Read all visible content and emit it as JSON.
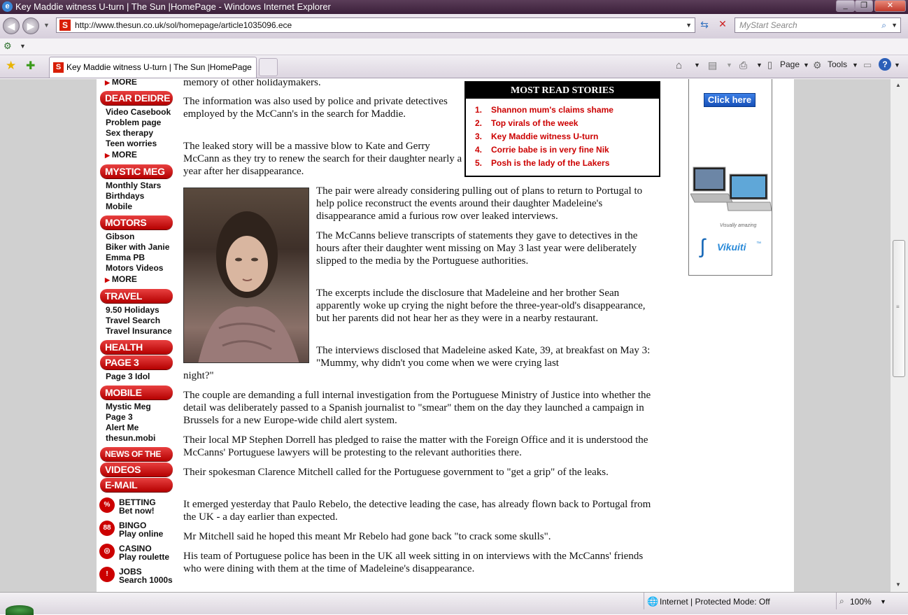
{
  "window": {
    "title": "Key Maddie witness U-turn | The Sun |HomePage - Windows Internet Explorer",
    "minimize": "_",
    "maximize": "❐",
    "close": "✕"
  },
  "browser": {
    "url": "http://www.thesun.co.uk/sol/homepage/article1035096.ece",
    "search_placeholder": "MyStart Search",
    "tab_title": "Key Maddie witness U-turn | The Sun |HomePage",
    "tools": {
      "page": "Page",
      "tools": "Tools"
    },
    "status_zone": "Internet | Protected Mode: Off",
    "zoom": "100%"
  },
  "leftnav": {
    "top_more": "MORE",
    "dear_deidre": {
      "title": "DEAR DEIDRE",
      "items": [
        "Video Casebook",
        "Problem page",
        "Sex therapy",
        "Teen worries"
      ],
      "more": "MORE"
    },
    "mystic_meg": {
      "title": "MYSTIC MEG",
      "items": [
        "Monthly Stars",
        "Birthdays",
        "Mobile"
      ]
    },
    "motors": {
      "title": "MOTORS",
      "items": [
        "Gibson",
        "Biker with Janie",
        "Emma PB",
        "Motors Videos"
      ],
      "more": "MORE"
    },
    "travel": {
      "title": "TRAVEL",
      "items": [
        "9.50 Holidays",
        "Travel Search",
        "Travel Insurance"
      ]
    },
    "health": {
      "title": "HEALTH"
    },
    "page3": {
      "title": "PAGE 3",
      "items": [
        "Page 3 Idol"
      ]
    },
    "mobile": {
      "title": "MOBILE",
      "items": [
        "Mystic Meg",
        "Page 3",
        "Alert Me",
        "thesun.mobi"
      ]
    },
    "news_of_the_world": "NEWS OF THE WORLD",
    "videos": "VIDEOS",
    "email_alerts": "E-MAIL ALERTS",
    "promos": [
      {
        "title": "BETTING",
        "sub": "Bet now!",
        "icon": "%"
      },
      {
        "title": "BINGO",
        "sub": "Play online",
        "icon": "88"
      },
      {
        "title": "CASINO",
        "sub": "Play roulette",
        "icon": "◎"
      },
      {
        "title": "JOBS",
        "sub": "Search 1000s",
        "icon": "!"
      }
    ]
  },
  "article": {
    "p0": "memory of other holidaymakers.",
    "p1": "The information was also used by police and private detectives employed by the McCann's in the search for Maddie.",
    "p2": "The leaked story will be a massive blow to Kate and Gerry McCann as they try to renew the search for their daughter nearly a year after her disappearance.",
    "p3": "The pair were already considering pulling out of plans to return to Portugal to help police reconstruct the events around their daughter Madeleine's disappearance amid a furious row over leaked interviews.",
    "p4": "The McCanns believe transcripts of statements they gave to detectives in the hours after their daughter went missing on May 3 last year were deliberately slipped to the media by the Portuguese authorities.",
    "p5": "The excerpts include the disclosure that Madeleine and her brother Sean apparently woke up crying the night before the three-year-old's disappearance, but her parents did not hear her as they were in a nearby restaurant.",
    "p6a": "The interviews disclosed that Madeleine asked Kate, 39, at breakfast on May 3: \"Mummy, why didn't you come when we were crying last",
    "p6b": "night?\"",
    "p7": "The couple are demanding a full internal investigation from the Portuguese Ministry of Justice into whether the detail was deliberately passed to a Spanish journalist to \"smear\" them on the day they launched a campaign in Brussels for a new Europe-wide child alert system.",
    "p8": "Their local MP Stephen Dorrell has pledged to raise the matter with the Foreign Office and it is understood the McCanns' Portuguese lawyers will be protesting to the relevant authorities there.",
    "p9": "Their spokesman Clarence Mitchell called for the Portuguese government to \"get a grip\" of the leaks.",
    "p10": "It emerged yesterday that Paulo Rebelo, the detective leading the case, has already flown back to Portugal from the UK - a day earlier than expected.",
    "p11": "Mr Mitchell said he hoped this meant Mr Rebelo had gone back \"to crack some skulls\".",
    "p12": "His team of Portuguese police has been in the UK all week sitting in on interviews with the McCanns' friends who were dining with them at the time of Madeleine's disappearance."
  },
  "most_read": {
    "title": "MOST READ STORIES",
    "items": [
      {
        "num": "1.",
        "text": "Shannon mum's claims shame"
      },
      {
        "num": "2.",
        "text": "Top virals of the week"
      },
      {
        "num": "3.",
        "text": "Key Maddie witness U-turn"
      },
      {
        "num": "4.",
        "text": "Corrie babe is in very fine Nik"
      },
      {
        "num": "5.",
        "text": "Posh is the lady of the Lakers"
      }
    ]
  },
  "ad": {
    "button": "Click here",
    "tagline": "Visually amazing",
    "brand": "Vikuiti",
    "tm": "™"
  },
  "colors": {
    "brand_red": "#c00000",
    "titlebar": "#3b1f3a"
  }
}
